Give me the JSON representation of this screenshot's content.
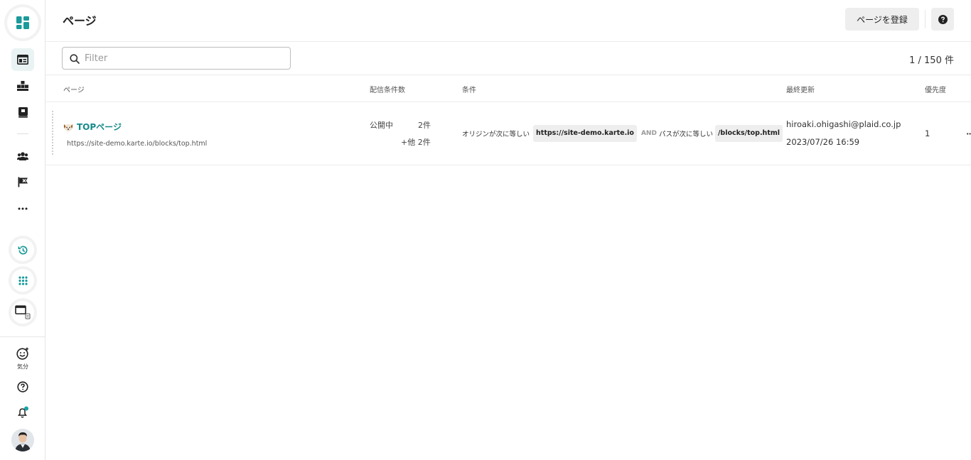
{
  "sidebar": {
    "mood_label": "気分"
  },
  "header": {
    "title": "ページ",
    "register_label": "ページを登録"
  },
  "filter": {
    "placeholder": "Filter",
    "value": ""
  },
  "pagination": {
    "count_text": "1 / 150 件"
  },
  "table": {
    "columns": {
      "page": "ページ",
      "delivery_count": "配信条件数",
      "conditions": "条件",
      "last_updated": "最終更新",
      "priority": "優先度"
    },
    "rows": [
      {
        "name": "TOPページ",
        "url": "https://site-demo.karte.io/blocks/top.html",
        "status": "公開中",
        "status_count": "2件",
        "others": "+他 2件",
        "cond_label1": "オリジンが次に等しい",
        "cond_value1": "https://site-demo.karte.io",
        "cond_op": "AND",
        "cond_label2": "パスが次に等しい",
        "cond_value2": "/blocks/top.html",
        "updated_by": "hiroaki.ohigashi@plaid.co.jp",
        "updated_at": "2023/07/26 16:59",
        "priority": "1"
      }
    ]
  },
  "colors": {
    "accent": "#168a8a",
    "active_bg": "#e9f3f3",
    "border": "#e6e6e6"
  }
}
